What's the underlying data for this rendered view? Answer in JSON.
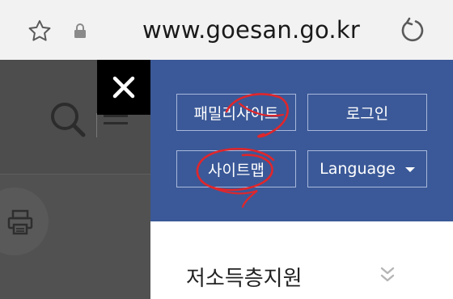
{
  "browser": {
    "url": "www.goesan.go.kr",
    "icons": [
      "star-icon",
      "lock-icon",
      "reload-icon"
    ]
  },
  "page_background": {
    "icons": [
      "search-icon",
      "hamburger-icon",
      "print-icon"
    ]
  },
  "close": {
    "icon": "close-icon"
  },
  "menu": {
    "panel_color": "#3b5998",
    "buttons": {
      "family_site": "패밀리사이트",
      "login": "로그인",
      "sitemap": "사이트맵",
      "language": "Language"
    },
    "items": [
      {
        "label": "저소득층지원",
        "icon": "double-chevron-down-icon"
      }
    ]
  },
  "annotations": {
    "color": "#e0262b",
    "targets": [
      "family_site",
      "sitemap"
    ]
  }
}
